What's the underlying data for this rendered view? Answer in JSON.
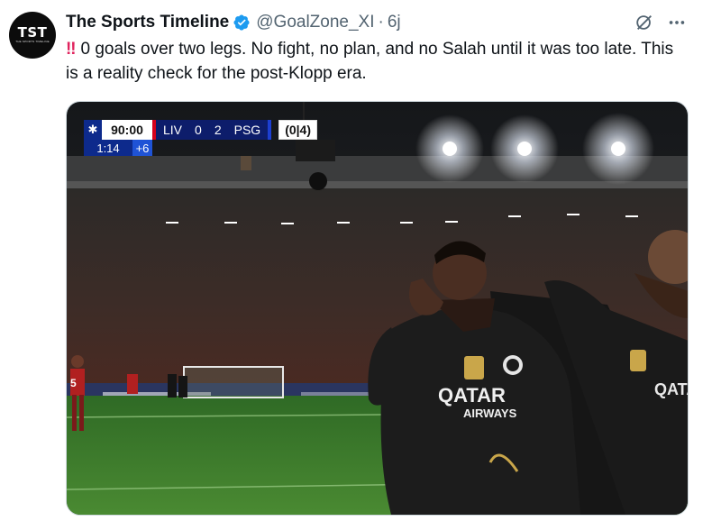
{
  "tweet": {
    "avatar": {
      "logo_text": "TST",
      "logo_subtext": "THE SPORTS TIMELINE"
    },
    "author_name": "The Sports Timeline",
    "handle": "@GoalZone_XI",
    "separator": "·",
    "time": "6j",
    "text": "0 goals over two legs. No fight, no plan, and no Salah until it was too late. This is a reality check for the post-Klopp era.",
    "icons": [
      "verified-badge-icon",
      "grok-icon",
      "more-icon",
      "double-exclamation-emoji"
    ]
  },
  "scorebug": {
    "clock": "90:00",
    "home": "LIV",
    "home_score": "0",
    "away_score": "2",
    "away": "PSG",
    "aggregate": "(0|4)",
    "stoppage_elapsed": "1:14",
    "stoppage_added": "+6"
  },
  "photo": {
    "player_number": "5",
    "sponsor_line1": "QATAR",
    "sponsor_line2": "AIRWAYS"
  },
  "colors": {
    "verified": "#1d9bf0",
    "muted": "#536471",
    "text": "#0f1419",
    "pitch": "#3a7a2a"
  }
}
